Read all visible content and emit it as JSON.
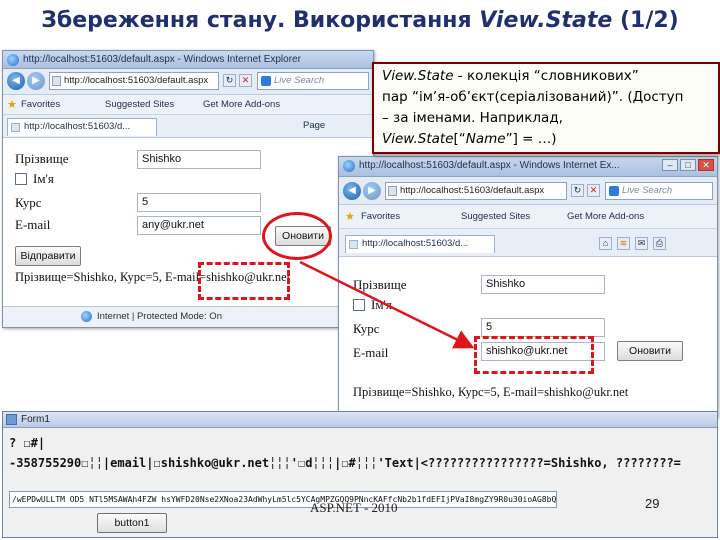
{
  "slide": {
    "title_main": "Збереження стану. Використання ",
    "title_em": "View.State",
    "title_tail": " (1/2)"
  },
  "browser_back": {
    "title": "http://localhost:51603/default.aspx - Windows Internet Explorer",
    "address": "http://localhost:51603/default.aspx",
    "search_placeholder": "Live Search",
    "favorites_label": "Favorites",
    "suggested_sites": "Suggested Sites",
    "addons": "Get More Add-ons",
    "tab_title": "http://localhost:51603/d...",
    "page_menu": "Page",
    "labels": {
      "surname": "Прізвище",
      "name": "Ім'я",
      "course": "Курс",
      "email": "E-mail"
    },
    "values": {
      "surname": "Shishko",
      "course": "5",
      "email": "any@ukr.net"
    },
    "submit_label": "Відправити",
    "update_label": "Оновити",
    "result": "Прізвище=Shishko, Курс=5, E-mail=shishko@ukr.net",
    "status": "Internet | Protected Mode: On"
  },
  "browser_front": {
    "title": "http://localhost:51603/default.aspx - Windows Internet Ex...",
    "address": "http://localhost:51603/default.aspx",
    "search_placeholder": "Live Search",
    "favorites_label": "Favorites",
    "suggested_sites": "Suggested Sites",
    "addons": "Get More Add-ons",
    "tab_title": "http://localhost:51603/d...",
    "labels": {
      "surname": "Прізвище",
      "name": "Ім'я",
      "course": "Курс",
      "email": "E-mail"
    },
    "values": {
      "surname": "Shishko",
      "course": "5",
      "email": "shishko@ukr.net"
    },
    "update_label": "Оновити",
    "result": "Прізвище=Shishko, Курс=5, E-mail=shishko@ukr.net"
  },
  "callout": {
    "line1_em": "View.State",
    "line1_rest": " - колекція “словникових”",
    "line2": "пар “ім’я-об’єкт(серіалізований)”. (Доступ",
    "line3": "– за іменами. Наприклад,",
    "line4_em1": "View.State",
    "line4_mid": "[“",
    "line4_em2": "Name",
    "line4_end": "”] = …)"
  },
  "form1": {
    "title": "Form1",
    "line1": "?  ☐#|",
    "line2": "-358755290☐╎╎|email|☐shishko@ukr.net╎╎╎'☐d╎╎╎|☐#╎╎╎'Text|<????????????????=Shishko, ????????=",
    "viewstate": "/wEPDwULLTM OD5 NTl5MSAWAh4FZW hsYWFD20Nse2XNoa23AdWhyLm5lc5YCAgMPZGQQ9PNncKAFfcNb2b1fdEFIjPVaI8mgZY9R0u30ioAG8bQt0Cy0JlidCITVNoe23Ao==",
    "button_label": "button1"
  },
  "footer": {
    "text": "ASP.NET - 2010",
    "page": "29"
  },
  "colors": {
    "title": "#1f2f6f",
    "accent_red": "#e0151b",
    "callout_border": "#7a0000"
  }
}
